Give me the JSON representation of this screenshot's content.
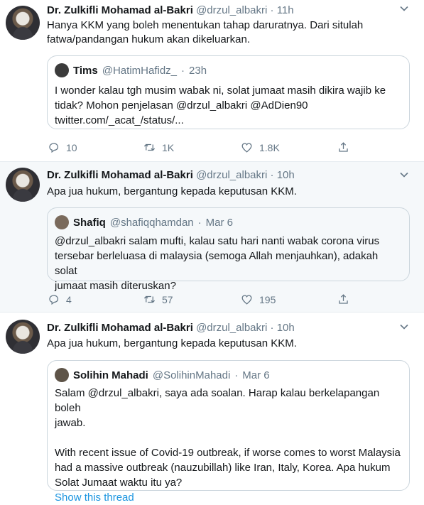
{
  "tweets": [
    {
      "author": {
        "name": "Dr. Zulkifli Mohamad al-Bakri",
        "handle": "@drzul_albakri",
        "time": "11h"
      },
      "text_lines": [
        "Hanya KKM yang boleh menentukan tahap daruratnya.  Dari situlah",
        "fatwa/pandangan hukum akan dikeluarkan."
      ],
      "quote": {
        "name": "Tims",
        "handle": "@HatimHafidz_",
        "time": "23h",
        "lines": [
          "I wonder kalau tgh musim wabak ni, solat jumaat masih dikira wajib ke",
          "tidak? Mohon penjelasan @drzul_albakri @AdDien90",
          "twitter.com/_acat_/status/..."
        ]
      },
      "actions": {
        "replies": "10",
        "retweets": "1K",
        "likes": "1.8K"
      }
    },
    {
      "author": {
        "name": "Dr. Zulkifli Mohamad al-Bakri",
        "handle": "@drzul_albakri",
        "time": "10h"
      },
      "text_lines": [
        "Apa jua hukum, bergantung kepada keputusan KKM."
      ],
      "quote": {
        "name": "Shafiq",
        "handle": "@shafiqqhamdan",
        "time": "Mar 6",
        "lines": [
          "@drzul_albakri salam mufti, kalau satu hari nanti wabak corona virus",
          "tersebar berleluasa di malaysia (semoga Allah menjauhkan), adakah solat",
          "jumaat masih diteruskan?"
        ]
      },
      "actions": {
        "replies": "4",
        "retweets": "57",
        "likes": "195"
      }
    },
    {
      "author": {
        "name": "Dr. Zulkifli Mohamad al-Bakri",
        "handle": "@drzul_albakri",
        "time": "10h"
      },
      "text_lines": [
        "Apa jua hukum, bergantung kepada keputusan KKM."
      ],
      "quote": {
        "name": "Solihin Mahadi",
        "handle": "@SolihinMahadi",
        "time": "Mar 6",
        "lines": [
          "Salam @drzul_albakri, saya ada soalan. Harap kalau berkelapangan boleh",
          "jawab.",
          "",
          "With recent issue of Covid-19 outbreak, if worse comes to worst Malaysia",
          "had a massive outbreak (nauzubillah) like Iran, Italy, Korea. Apa hukum",
          "Solat Jumaat waktu itu ya?"
        ],
        "show_thread": "Show this thread"
      }
    }
  ],
  "separator": "·"
}
